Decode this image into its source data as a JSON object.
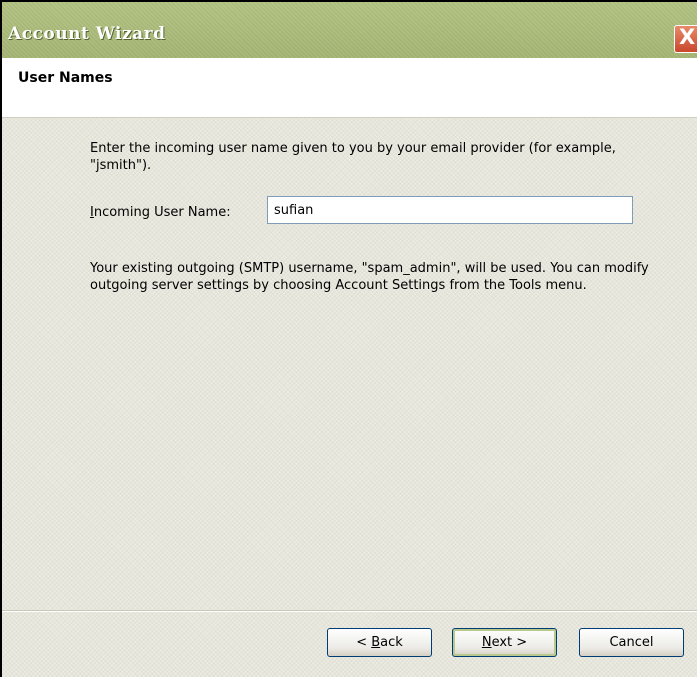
{
  "window": {
    "title": "Account Wizard",
    "close_glyph": "X"
  },
  "header": {
    "title": "User Names"
  },
  "main": {
    "description": "Enter the incoming user name given to you by your email provider (for example, \"jsmith\").",
    "incoming_label_prefix": "I",
    "incoming_label_rest": "ncoming User Name:",
    "incoming_value": "sufian",
    "outgoing_note": "Your existing outgoing (SMTP) username, \"spam_admin\", will be used. You can modify outgoing server settings by choosing Account Settings from the Tools menu."
  },
  "buttons": {
    "back_prefix": "< ",
    "back_accel": "B",
    "back_rest": "ack",
    "next_accel": "N",
    "next_rest": "ext >",
    "cancel": "Cancel"
  },
  "colors": {
    "titlebar": "#a7b878",
    "content_bg": "#ecebe2",
    "close_button": "#c9472c"
  }
}
